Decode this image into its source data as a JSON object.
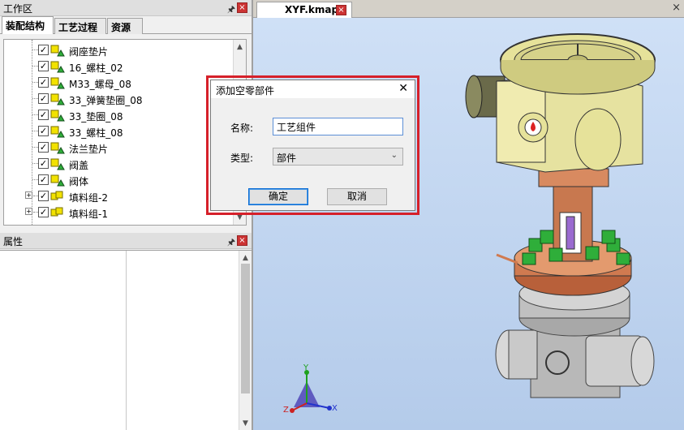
{
  "workspace": {
    "title": "工作区",
    "tabs": [
      {
        "label": "装配结构",
        "active": true
      },
      {
        "label": "工艺过程",
        "active": false
      },
      {
        "label": "资源",
        "active": false
      }
    ],
    "tree": [
      {
        "label": "阀座垫片",
        "checked": true,
        "kind": "part"
      },
      {
        "label": "16_螺柱_02",
        "checked": true,
        "kind": "part"
      },
      {
        "label": "M33_螺母_08",
        "checked": true,
        "kind": "part"
      },
      {
        "label": "33_弹簧垫圈_08",
        "checked": true,
        "kind": "part"
      },
      {
        "label": "33_垫圈_08",
        "checked": true,
        "kind": "part"
      },
      {
        "label": "33_螺柱_08",
        "checked": true,
        "kind": "part"
      },
      {
        "label": "法兰垫片",
        "checked": true,
        "kind": "part"
      },
      {
        "label": "阀盖",
        "checked": true,
        "kind": "part"
      },
      {
        "label": "阀体",
        "checked": true,
        "kind": "part"
      },
      {
        "label": "填料组-2",
        "checked": true,
        "kind": "group",
        "expander": "+"
      },
      {
        "label": "填料组-1",
        "checked": true,
        "kind": "group",
        "expander": "+"
      }
    ]
  },
  "properties": {
    "title": "属性"
  },
  "document": {
    "tab_label": "XYF.kmapd"
  },
  "axes": {
    "x": "X",
    "y": "Y",
    "z": "Z"
  },
  "dialog": {
    "title": "添加空零部件",
    "name_label": "名称:",
    "name_value": "工艺组件",
    "type_label": "类型:",
    "type_value": "部件",
    "ok_label": "确定",
    "cancel_label": "取消"
  },
  "colors": {
    "highlight_border": "#d6202a",
    "handwheel": "#e6e29a",
    "bonnet": "#c8784f",
    "bolts": "#2fae3a"
  }
}
